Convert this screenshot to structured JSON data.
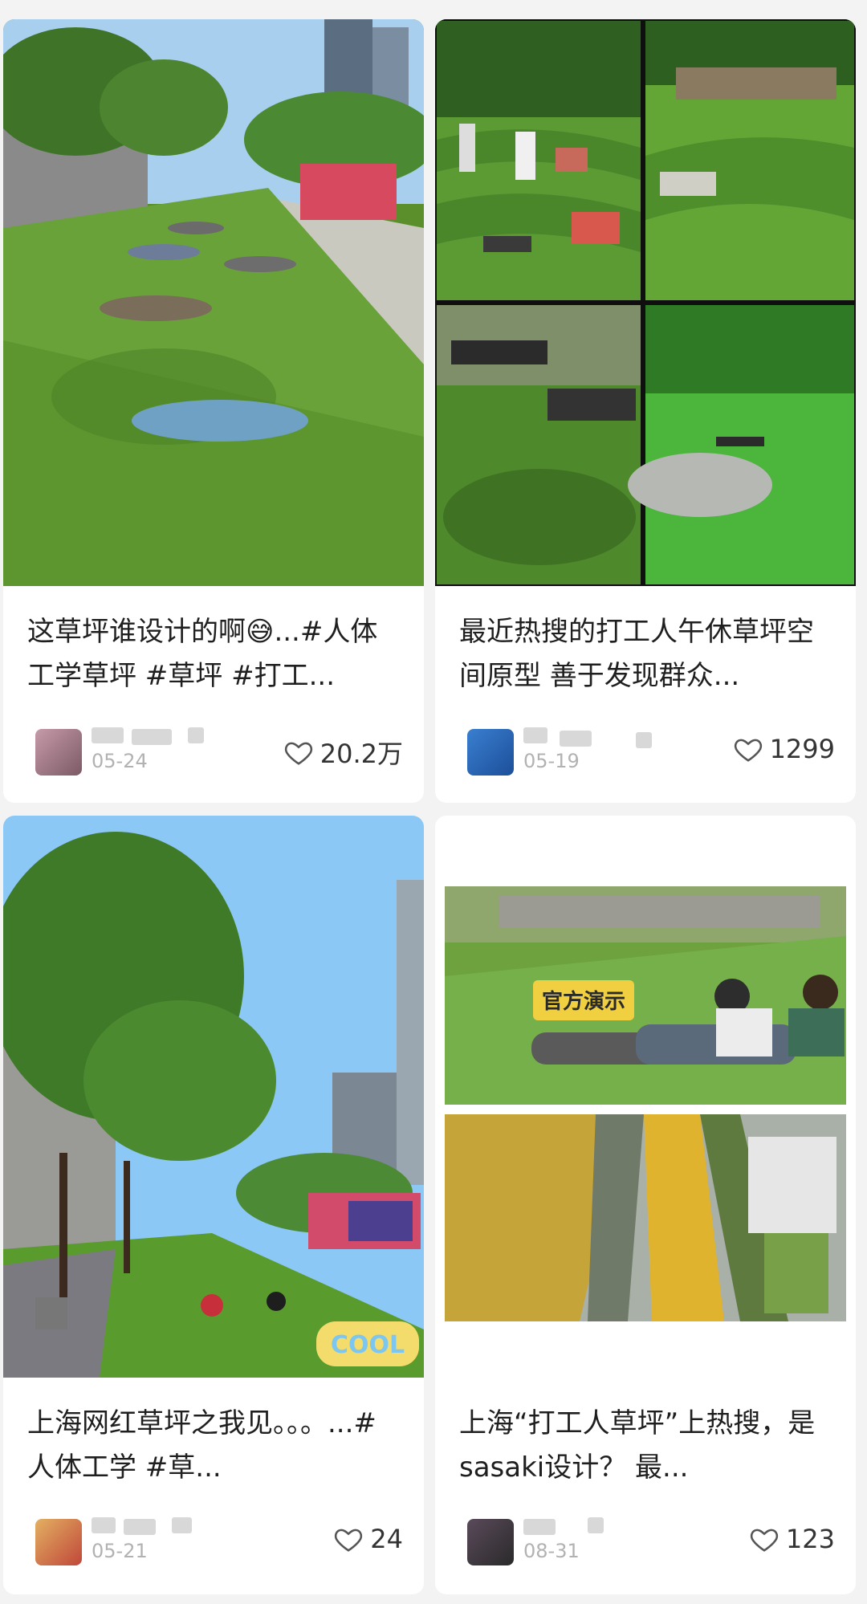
{
  "feed": [
    {
      "title": "这草坪谁设计的啊😅...#人体工学草坪 #草坪 #打工...",
      "date": "05-24",
      "likes": "20.2万"
    },
    {
      "title": "最近热搜的打工人午休草坪空间原型 善于发现群众...",
      "date": "05-19",
      "likes": "1299"
    },
    {
      "title": "上海网红草坪之我见。。。...#人体工学 #草...",
      "date": "05-21",
      "likes": "24"
    },
    {
      "title": "上海“打工人草坪”上热搜，是sasaki设计？ 最...",
      "date": "08-31",
      "likes": "123",
      "image_top_caption": "官方演示"
    }
  ],
  "stickers": {
    "cool": "COOL"
  },
  "colors": {
    "background": "#f3f3f3",
    "card": "#ffffff",
    "grass": "#6d9b3a",
    "sky": "#8cc8f5"
  }
}
